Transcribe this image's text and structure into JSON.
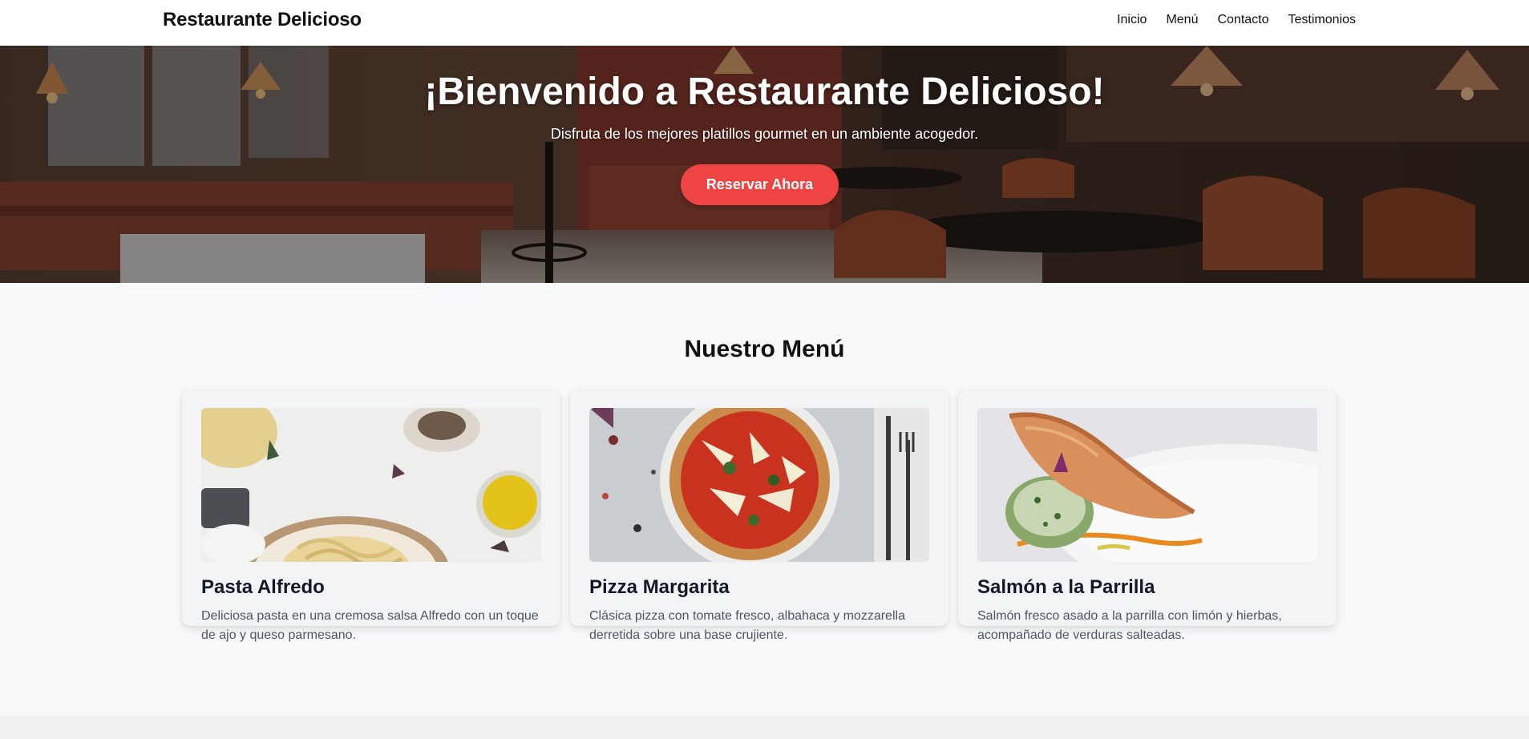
{
  "navbar": {
    "brand": "Restaurante Delicioso",
    "links": [
      "Inicio",
      "Menú",
      "Contacto",
      "Testimonios"
    ]
  },
  "hero": {
    "title": "¡Bienvenido a Restaurante Delicioso!",
    "subtitle": "Disfruta de los mejores platillos gourmet en un ambiente acogedor.",
    "button_label": "Reservar Ahora"
  },
  "menu": {
    "title": "Nuestro Menú",
    "items": [
      {
        "name": "Pasta Alfredo",
        "description": "Deliciosa pasta en una cremosa salsa Alfredo con un toque de ajo y queso parmesano."
      },
      {
        "name": "Pizza Margarita",
        "description": "Clásica pizza con tomate fresco, albahaca y mozzarella derretida sobre una base crujiente."
      },
      {
        "name": "Salmón a la Parrilla",
        "description": "Salmón fresco asado a la parrilla con limón y hierbas, acompañado de verduras salteadas."
      }
    ]
  },
  "colors": {
    "accent": "#ef4444",
    "background": "#f8f9fa",
    "card": "#f3f4f6",
    "text": "#111827",
    "muted_text": "#4b5563"
  }
}
